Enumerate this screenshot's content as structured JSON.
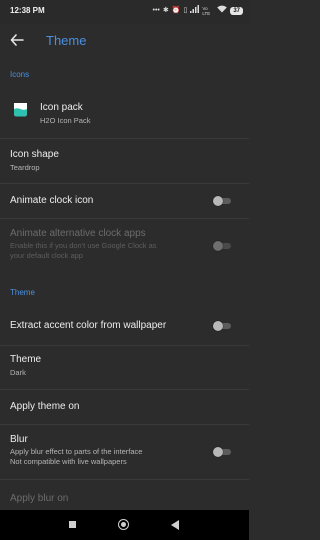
{
  "status_bar": {
    "time": "12:38 PM",
    "icons": [
      "more-icon",
      "bluetooth-icon",
      "alarm-icon",
      "vibrate-icon",
      "signal-icon",
      "volte-icon",
      "wifi-icon"
    ],
    "lte_label": "Vo LTE",
    "battery": "37"
  },
  "toolbar": {
    "title": "Theme"
  },
  "sections": {
    "icons_header": "Icons",
    "theme_header": "Theme"
  },
  "items": {
    "icon_pack": {
      "title": "Icon pack",
      "subtitle": "H2O Icon Pack"
    },
    "icon_shape": {
      "title": "Icon shape",
      "subtitle": "Teardrop"
    },
    "animate_clock": {
      "title": "Animate clock icon",
      "toggle": false
    },
    "animate_alt_clock": {
      "title": "Animate alternative clock apps",
      "subtitle_line1": "Enable this if you don't use Google Clock as",
      "subtitle_line2": "your default clock app",
      "toggle": false,
      "enabled": false
    },
    "extract_accent": {
      "title": "Extract accent color from wallpaper",
      "toggle": false
    },
    "theme": {
      "title": "Theme",
      "subtitle": "Dark"
    },
    "apply_theme_on": {
      "title": "Apply theme on"
    },
    "blur": {
      "title": "Blur",
      "subtitle_line1": "Apply blur effect to parts of the interface",
      "subtitle_line2": "Not compatible with live wallpapers",
      "toggle": false
    },
    "apply_blur_on": {
      "title": "Apply blur on",
      "enabled": false
    }
  },
  "colors": {
    "accent": "#4a90e2",
    "background": "#2c2c2c"
  }
}
